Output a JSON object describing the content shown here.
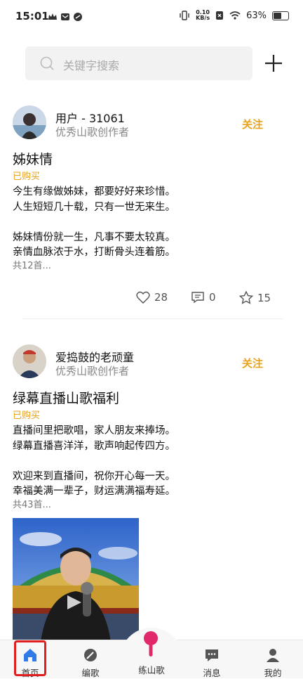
{
  "status_bar": {
    "time": "15:01",
    "net_speed_value": "0.10",
    "net_speed_unit": "KB/s",
    "battery": "63%",
    "battery_level": 0.63
  },
  "search": {
    "placeholder": "关键字搜索"
  },
  "posts": [
    {
      "user": "用户 - 31061",
      "role": "优秀山歌创作者",
      "follow_label": "关注",
      "title": "姊妹情",
      "bought": "已购买",
      "lyrics": "今生有缘做姊妹，都要好好来珍惜。\n人生短短几十载，只有一世无来生。\n\n姊妹情份就一生，凡事不要太较真。\n亲情血脉浓于水，打断骨头连着筋。",
      "more": "共12首...",
      "likes": "28",
      "comments": "0",
      "stars": "15"
    },
    {
      "user": "爱捣鼓的老顽童",
      "role": "优秀山歌创作者",
      "follow_label": "关注",
      "title": "绿幕直播山歌福利",
      "bought": "已购买",
      "lyrics": "直播间里把歌唱，家人朋友来捧场。\n绿幕直播喜洋洋，歌声响起传四方。\n\n欢迎来到直播间，祝你开心每一天。\n幸福美满一辈子，财运满满福寿延。",
      "more": "共43首..."
    }
  ],
  "nav": {
    "home": "首页",
    "compose": "编歌",
    "practice": "练山歌",
    "messages": "消息",
    "mine": "我的"
  },
  "colors": {
    "accent": "#e8a21c",
    "home_blue": "#2f7be8",
    "highlight": "#e02020",
    "mic_pink": "#e0286a"
  }
}
